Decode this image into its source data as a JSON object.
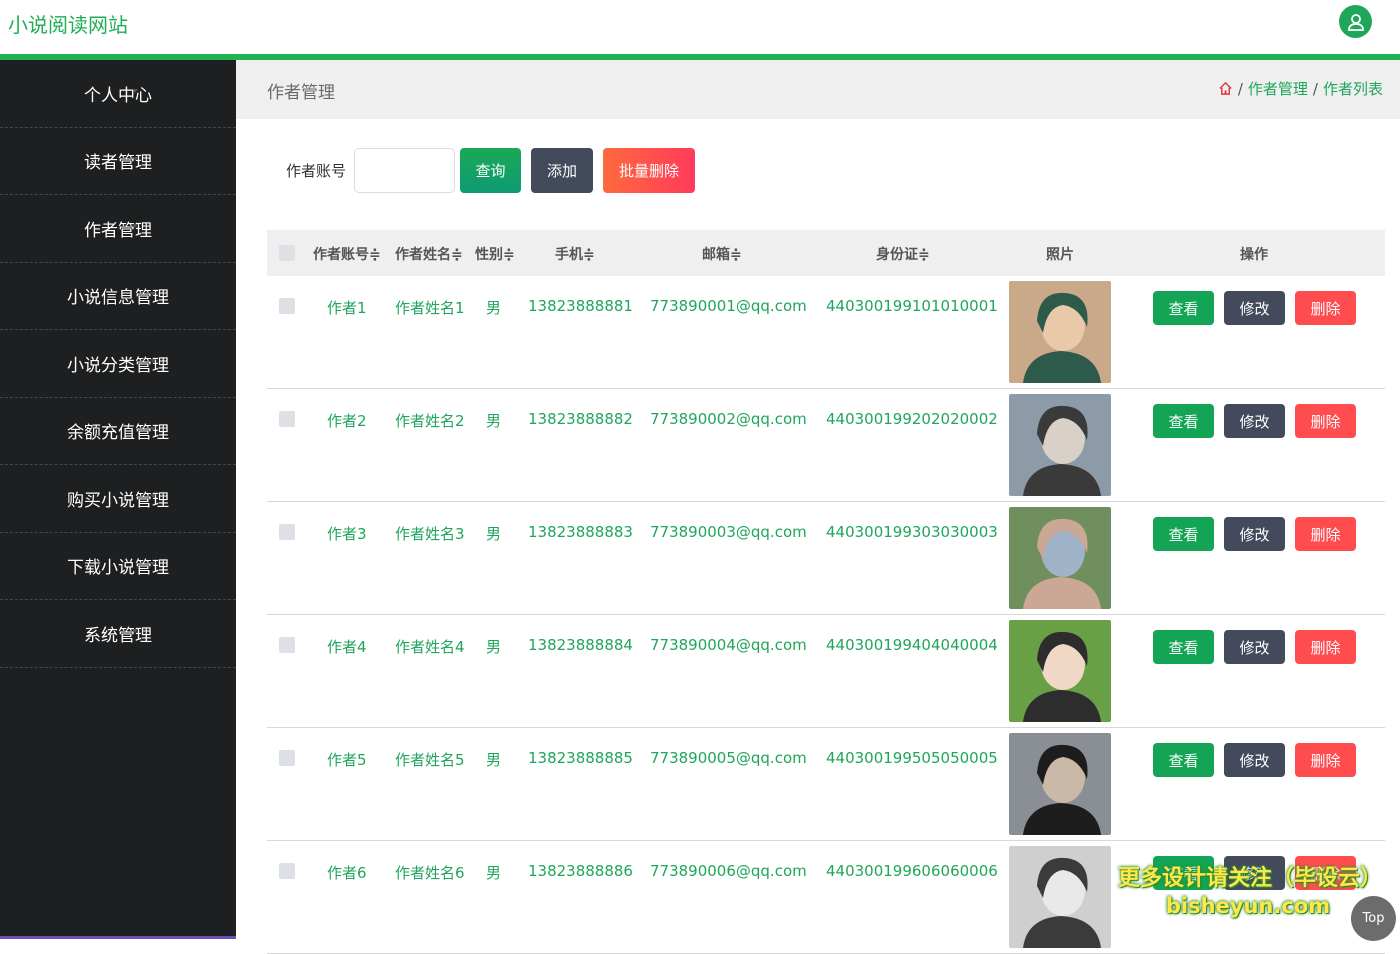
{
  "header": {
    "site_title": "小说阅读网站"
  },
  "colors": {
    "accent": "#1fa65b",
    "sidebar_bg": "#1e1f20",
    "view": "#13a555",
    "edit": "#434a5c",
    "delete": "#ff4d4f"
  },
  "sidebar": {
    "items": [
      {
        "label": "个人中心"
      },
      {
        "label": "读者管理"
      },
      {
        "label": "作者管理"
      },
      {
        "label": "小说信息管理"
      },
      {
        "label": "小说分类管理"
      },
      {
        "label": "余额充值管理"
      },
      {
        "label": "购买小说管理"
      },
      {
        "label": "下载小说管理"
      },
      {
        "label": "系统管理"
      }
    ]
  },
  "breadcrumb": {
    "page_title": "作者管理",
    "home_icon": "home-icon",
    "sep": "/",
    "level1": "作者管理",
    "level2": "作者列表"
  },
  "search": {
    "label": "作者账号",
    "value": "",
    "query_label": "查询",
    "add_label": "添加",
    "batch_delete_label": "批量删除"
  },
  "table": {
    "headers": {
      "account": "作者账号",
      "name": "作者姓名",
      "gender": "性别",
      "phone": "手机",
      "email": "邮箱",
      "idcard": "身份证",
      "photo": "照片",
      "actions": "操作"
    },
    "sort_icon": "≑",
    "action_labels": {
      "view": "查看",
      "edit": "修改",
      "delete": "删除"
    },
    "rows": [
      {
        "account": "作者1",
        "name": "作者姓名1",
        "gender": "男",
        "phone": "13823888881",
        "email": "773890001@qq.com",
        "idcard": "440300199101010001"
      },
      {
        "account": "作者2",
        "name": "作者姓名2",
        "gender": "男",
        "phone": "13823888882",
        "email": "773890002@qq.com",
        "idcard": "440300199202020002"
      },
      {
        "account": "作者3",
        "name": "作者姓名3",
        "gender": "男",
        "phone": "13823888883",
        "email": "773890003@qq.com",
        "idcard": "440300199303030003"
      },
      {
        "account": "作者4",
        "name": "作者姓名4",
        "gender": "男",
        "phone": "13823888884",
        "email": "773890004@qq.com",
        "idcard": "440300199404040004"
      },
      {
        "account": "作者5",
        "name": "作者姓名5",
        "gender": "男",
        "phone": "13823888885",
        "email": "773890005@qq.com",
        "idcard": "440300199505050005"
      },
      {
        "account": "作者6",
        "name": "作者姓名6",
        "gender": "男",
        "phone": "13823888886",
        "email": "773890006@qq.com",
        "idcard": "440300199606060006"
      }
    ]
  },
  "watermark": {
    "line1": "更多设计请关注（毕设云）",
    "line2": "bisheyun.com"
  },
  "back_to_top": "Top"
}
